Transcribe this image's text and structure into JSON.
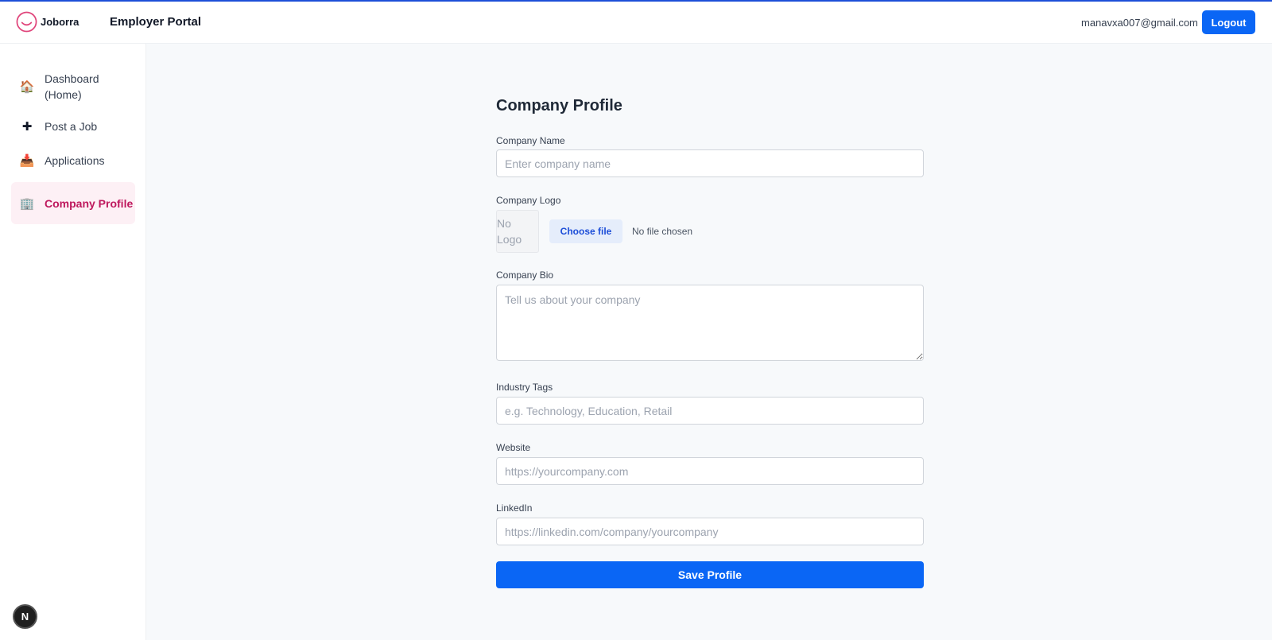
{
  "header": {
    "brand_name": "Joborra",
    "logo_icon": "smile-circle-icon",
    "brand_color": "#e0457b",
    "portal_title": "Employer Portal",
    "user_email": "manavxa007@gmail.com",
    "logout_label": "Logout",
    "accent_color": "#0a66f5"
  },
  "sidebar": {
    "items": [
      {
        "icon": "house-emoji",
        "glyph": "🏠",
        "label": "Dashboard (Home)",
        "active": false
      },
      {
        "icon": "plus-icon",
        "glyph": "✚",
        "label": "Post a Job",
        "active": false
      },
      {
        "icon": "inbox-tray-emoji",
        "glyph": "📥",
        "label": "Applications",
        "active": false
      },
      {
        "icon": "office-building-emoji",
        "glyph": "🏢",
        "label": "Company Profile",
        "active": true
      }
    ],
    "active_color": "#be185d"
  },
  "dev_badge": {
    "label": "N"
  },
  "form": {
    "title": "Company Profile",
    "company_name": {
      "label": "Company Name",
      "placeholder": "Enter company name",
      "value": ""
    },
    "company_logo": {
      "label": "Company Logo",
      "preview_text": "No Logo",
      "button_label": "Choose file",
      "status": "No file chosen"
    },
    "company_bio": {
      "label": "Company Bio",
      "placeholder": "Tell us about your company",
      "value": ""
    },
    "industry_tags": {
      "label": "Industry Tags",
      "placeholder": "e.g. Technology, Education, Retail",
      "value": ""
    },
    "website": {
      "label": "Website",
      "placeholder": "https://yourcompany.com",
      "value": ""
    },
    "linkedin": {
      "label": "LinkedIn",
      "placeholder": "https://linkedin.com/company/yourcompany",
      "value": ""
    },
    "save_label": "Save Profile"
  }
}
